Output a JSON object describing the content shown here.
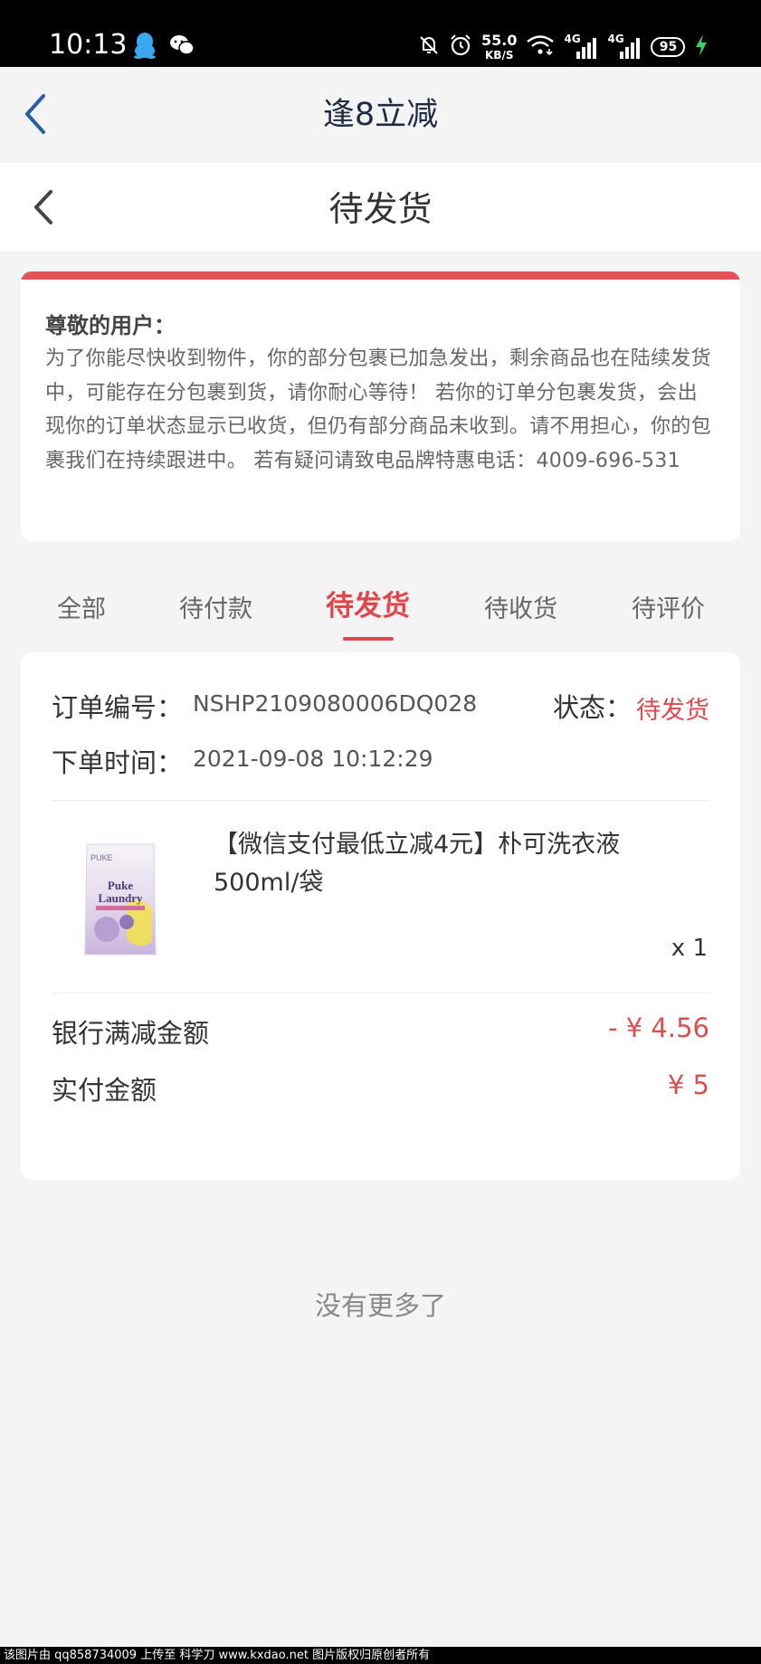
{
  "status_bar": {
    "time": "10:13",
    "net_speed_value": "55.0",
    "net_speed_unit": "KB/S",
    "network1": "4G",
    "network2": "4G",
    "battery": "95",
    "icons": [
      "qq-icon",
      "wechat-icon",
      "mute-icon",
      "alarm-icon",
      "wifi-icon",
      "signal-icon",
      "charging-icon"
    ]
  },
  "app_header": {
    "title": "逢8立减"
  },
  "page_header": {
    "title": "待发货"
  },
  "notice": {
    "heading": "尊敬的用户：",
    "body": "为了你能尽快收到物件，你的部分包裹已加急发出，剩余商品也在陆续发货中，可能存在分包裹到货，请你耐心等待！ 若你的订单分包裹发货，会出现你的订单状态显示已收货，但仍有部分商品未收到。请不用担心，你的包裹我们在持续跟进中。 若有疑问请致电品牌特惠电话：4009-696-531"
  },
  "tabs": [
    {
      "label": "全部"
    },
    {
      "label": "待付款"
    },
    {
      "label": "待发货"
    },
    {
      "label": "待收货"
    },
    {
      "label": "待评价"
    }
  ],
  "order": {
    "number_label": "订单编号：",
    "number_value": "NSHP2109080006DQ028",
    "status_label": "状态：",
    "status_value": "待发货",
    "time_label": "下单时间：",
    "time_value": "2021-09-08 10:12:29",
    "product": {
      "title": "【微信支付最低立减4元】朴可洗衣液500ml/袋",
      "image_brand": "PUKE",
      "image_line1": "Puke",
      "image_line2": "Laundry",
      "quantity": "x 1"
    },
    "bank_discount_label": "银行满减金额",
    "bank_discount_value": "- ¥ 4.56",
    "paid_label": "实付金额",
    "paid_value": "¥ 5"
  },
  "no_more": "没有更多了",
  "watermark": "该图片由 qq858734009 上传至 科学刀 www.kxdao.net 图片版权归原创者所有",
  "colors": {
    "accent": "#e0474c",
    "notice_bar": "#e25357",
    "price": "#d94f4f",
    "nav_back": "#2a5ea8"
  }
}
